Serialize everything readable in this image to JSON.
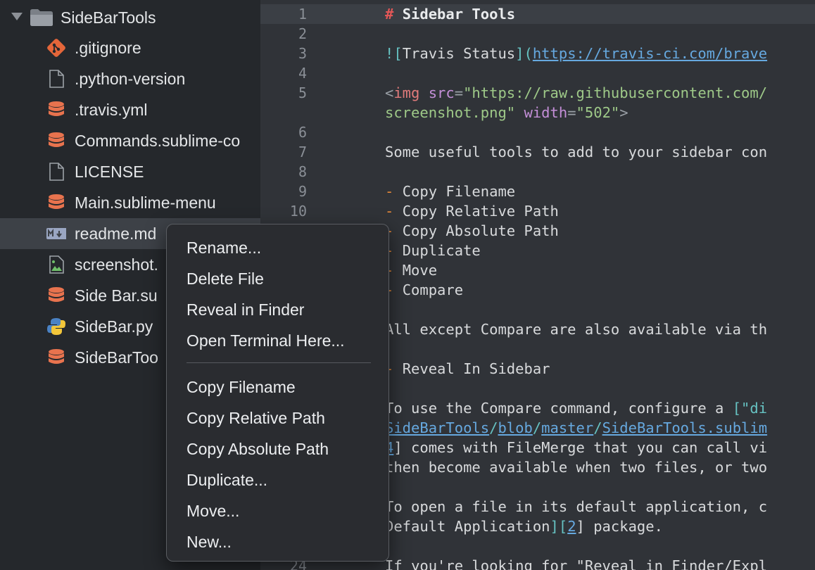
{
  "sidebar": {
    "folder": {
      "label": "SideBarTools",
      "icon": "folder-icon",
      "disclosure": "expanded"
    },
    "files": [
      {
        "label": ".gitignore",
        "icon": "git-icon",
        "selected": false
      },
      {
        "label": ".python-version",
        "icon": "blank-file-icon",
        "selected": false
      },
      {
        "label": ".travis.yml",
        "icon": "database-icon",
        "selected": false
      },
      {
        "label": "Commands.sublime-co",
        "icon": "database-icon",
        "selected": false
      },
      {
        "label": "LICENSE",
        "icon": "blank-file-icon",
        "selected": false
      },
      {
        "label": "Main.sublime-menu",
        "icon": "database-icon",
        "selected": false
      },
      {
        "label": "readme.md",
        "icon": "markdown-icon",
        "selected": true
      },
      {
        "label": "screenshot.",
        "icon": "image-file-icon",
        "selected": false
      },
      {
        "label": "Side Bar.su",
        "icon": "database-icon",
        "selected": false
      },
      {
        "label": "SideBar.py",
        "icon": "python-icon",
        "selected": false
      },
      {
        "label": "SideBarToo",
        "icon": "database-icon",
        "selected": false
      }
    ]
  },
  "editor": {
    "gutter": [
      "1",
      "2",
      "3",
      "4",
      "5",
      "6",
      "7",
      "8",
      "9",
      "10",
      "24"
    ],
    "lines": {
      "l1_hash": "# ",
      "l1_text": "Sidebar Tools",
      "l3_open": "![",
      "l3_text": "Travis Status",
      "l3_mid": "](",
      "l3_url": "https://travis-ci.com/brave",
      "l5_lt": "<",
      "l5_tag": "img",
      "l5_attr": " src",
      "l5_eq": "=",
      "l5_val": "\"https://raw.githubusercontent.com/",
      "l5b_val": "screenshot.png\"",
      "l5b_attr": " width",
      "l5b_eq": "=",
      "l5b_val2": "\"502\"",
      "l5b_gt": ">",
      "l7": "Some useful tools to add to your sidebar con",
      "b1_dash": "- ",
      "b1": "Copy Filename",
      "b2_dash": "- ",
      "b2": "Copy Relative Path",
      "b3_dash": "- ",
      "b3": "Copy Absolute Path",
      "b4_dash": "- ",
      "b4": "Duplicate",
      "b5_dash": "- ",
      "b5": "Move",
      "b6_dash": "- ",
      "b6": "Compare",
      "l17": "All except Compare are also available via th",
      "l19_dash": "- ",
      "l19": "Reveal In Sidebar",
      "l21a": "To use the Compare command, configure a ",
      "l21b": "[\"di",
      "l22a": "SideBarTools",
      "l22b": "/",
      "l22c": "blob",
      "l22d": "/",
      "l22e": "master",
      "l22f": "/",
      "l22g": "SideBarTools.sublim",
      "l23a": "4",
      "l23b": "] comes with FileMerge that you can call vi",
      "l24": "then become available when two files, or two",
      "l26": "To open a file in its default application, c",
      "l27a": "Default Application",
      "l27b": "][",
      "l27c": "2",
      "l27d": "] package.",
      "l29": "If you're looking for \"Reveal in Finder/Expl"
    }
  },
  "context_menu": {
    "group1": [
      "Rename...",
      "Delete File",
      "Reveal in Finder",
      "Open Terminal Here..."
    ],
    "group2": [
      "Copy Filename",
      "Copy Relative Path",
      "Copy Absolute Path",
      "Duplicate...",
      "Move...",
      "New..."
    ]
  },
  "colors": {
    "sidebar_bg": "#25282c",
    "editor_bg": "#303338",
    "selection": "#3d4147",
    "menu_bg": "#2a2c30",
    "git_icon": "#e4663a",
    "database_icon": "#e8734e",
    "markdown_icon": "#9aa6c2",
    "python_blue": "#4a82c4",
    "python_yellow": "#f2c63a"
  }
}
